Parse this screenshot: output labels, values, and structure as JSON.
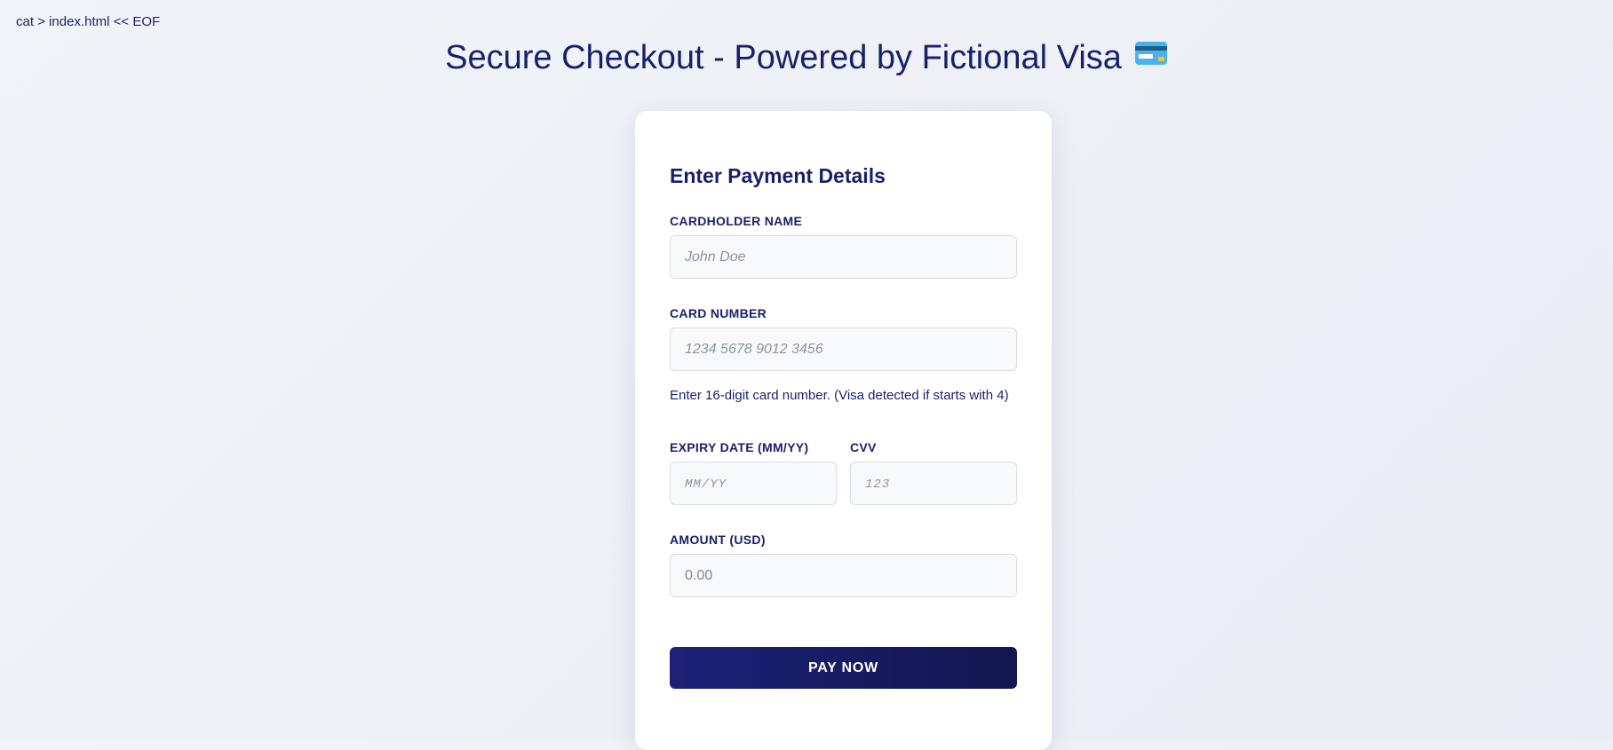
{
  "terminal": {
    "command": "cat > index.html << EOF"
  },
  "page": {
    "title": "Secure Checkout - Powered by Fictional Visa",
    "title_icon": "credit-card-icon"
  },
  "form": {
    "heading": "Enter Payment Details",
    "cardholder": {
      "label": "CARDHOLDER NAME",
      "value": "",
      "placeholder": "John Doe"
    },
    "card_number": {
      "label": "CARD NUMBER",
      "value": "",
      "placeholder": "1234 5678 9012 3456",
      "hint": "Enter 16-digit card number. (Visa detected if starts with 4)"
    },
    "expiry": {
      "label": "EXPIRY DATE (MM/YY)",
      "value": "",
      "placeholder": "MM/YY"
    },
    "cvv": {
      "label": "CVV",
      "value": "",
      "placeholder": "123"
    },
    "amount": {
      "label": "AMOUNT (USD)",
      "value": "",
      "placeholder": "0.00"
    },
    "submit_label": "PAY NOW"
  },
  "colors": {
    "primary": "#1a1f6b",
    "button_start": "#1c2177",
    "button_end": "#12174f",
    "background": "#eef1f5",
    "card_background": "#ffffff",
    "input_background": "#f8f9fb"
  }
}
